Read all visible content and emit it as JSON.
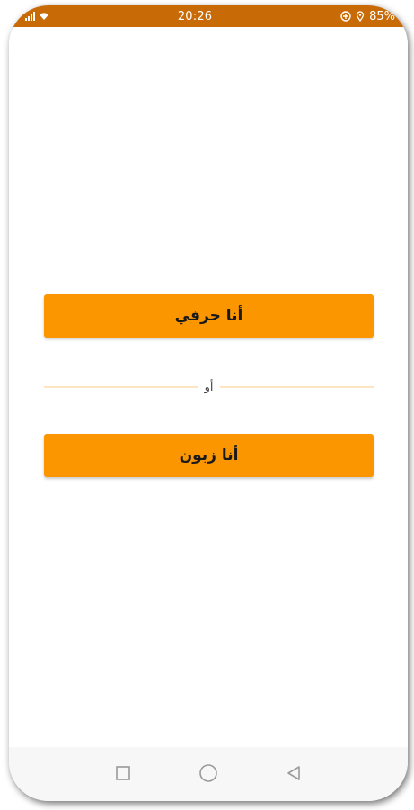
{
  "status_bar": {
    "time": "20:26",
    "battery": "85%",
    "icons": [
      "signal-icon",
      "wifi-icon",
      "data-saver-icon",
      "location-icon"
    ]
  },
  "main": {
    "artisan_button_label": "أنا حرفي",
    "divider_text": "أو",
    "client_button_label": "أنا زبون"
  },
  "nav_bar": {
    "icons": [
      "recent-apps-icon",
      "home-icon",
      "back-icon"
    ]
  },
  "colors": {
    "status_bar": "#c86a06",
    "accent": "#fb9500",
    "divider_line": "#fde5bf",
    "nav_bar": "#f7f7f7"
  }
}
